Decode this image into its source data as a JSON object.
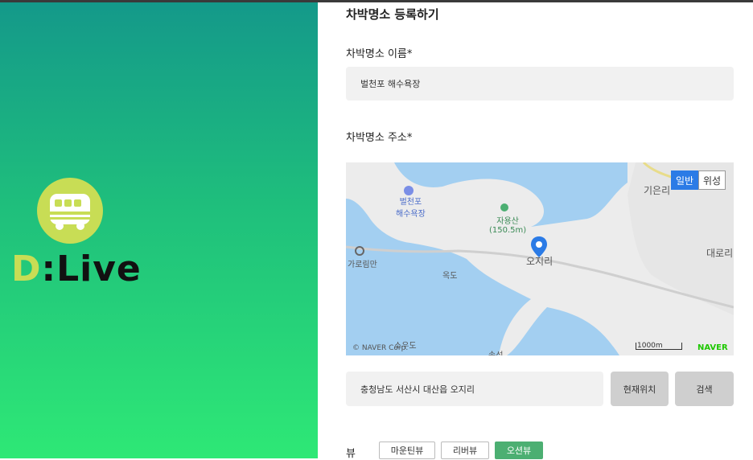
{
  "form": {
    "title": "차박명소 등록하기",
    "name_label": "차박명소 이름*",
    "name_value": "벌천포 해수욕장",
    "address_label": "차박명소 주소*",
    "address_value": "충청남도 서산시 대산읍 오지리",
    "current_location_button": "현재위치",
    "search_button": "검색"
  },
  "logo": {
    "text_d": "D",
    "text_rest": ":Live"
  },
  "map": {
    "toggle_normal": "일반",
    "toggle_satellite": "위성",
    "labels": {
      "beach": "벌천포\n해수욕장",
      "mountain": "자용산\n(150.5m)",
      "ojiri": "오지리",
      "giunri": "기은리",
      "daeri": "대로리",
      "garorim": "가로림만",
      "okdo": "옥도",
      "souodo": "소우도",
      "songseong": "송성"
    },
    "scale": "1000m",
    "copyright": "© NAVER Corp.",
    "brand": "NAVER",
    "colors": {
      "water": "#a3cff1",
      "land": "#ececec",
      "accent": "#2b7be6",
      "brand": "#1ec800"
    }
  },
  "view": {
    "label": "뷰",
    "options": [
      "마운틴뷰",
      "리버뷰",
      "오션뷰"
    ],
    "selected": "오션뷰",
    "accent": "#4caf72"
  }
}
